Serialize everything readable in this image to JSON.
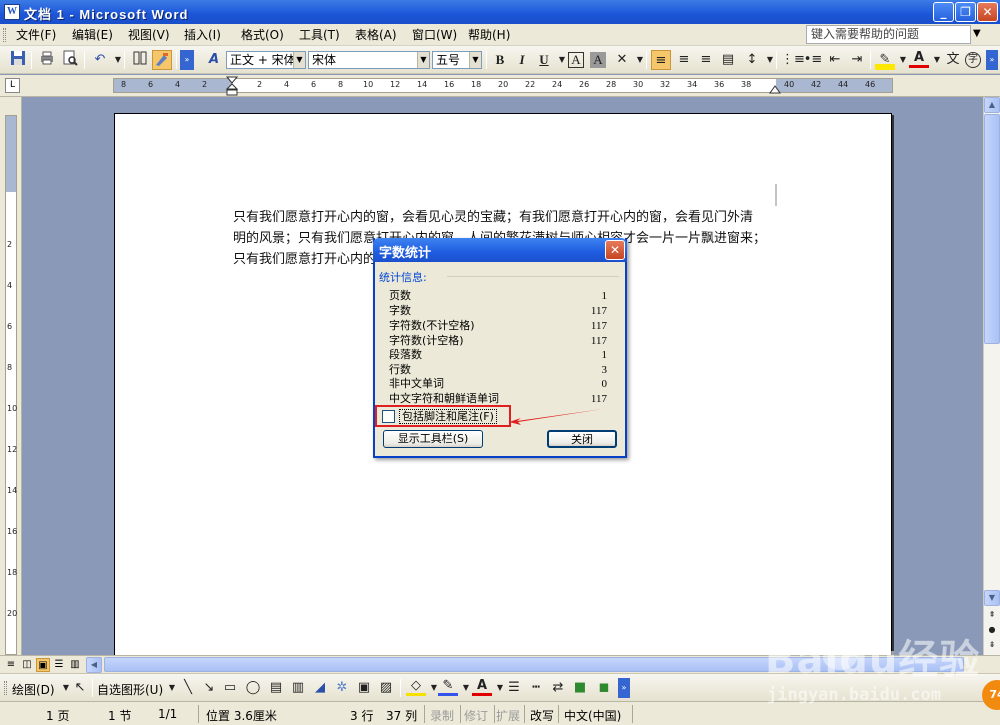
{
  "window": {
    "title": "文档 1 - Microsoft Word",
    "app_icon": "W",
    "controls": [
      "_",
      "❐",
      "✕"
    ]
  },
  "menubar": {
    "items": [
      "文件(F)",
      "编辑(E)",
      "视图(V)",
      "插入(I)",
      "格式(O)",
      "工具(T)",
      "表格(A)",
      "窗口(W)",
      "帮助(H)"
    ],
    "help_placeholder": "键入需要帮助的问题"
  },
  "toolbar": {
    "style_value": "正文 + 宋体",
    "font_value": "宋体",
    "size_value": "五号",
    "bold": "B",
    "italic": "I",
    "underline": "U",
    "char_border": "A",
    "char_shade": "A",
    "phonetic": "文",
    "icons": [
      "save-icon",
      "print-icon",
      "print-preview-icon",
      "undo-icon",
      "columns-icon",
      "drawing-icon",
      "styles-icon",
      "bold-icon",
      "italic-icon",
      "underline-icon",
      "align-left-icon",
      "center-icon",
      "align-right-icon",
      "justify-icon",
      "line-spacing-icon",
      "numbering-icon",
      "bullets-icon",
      "decrease-indent-icon",
      "increase-indent-icon",
      "highlight-icon",
      "font-color-icon"
    ]
  },
  "ruler": {
    "left_numbers": [
      "8",
      "6",
      "4",
      "2"
    ],
    "right_numbers": [
      "2",
      "4",
      "6",
      "8",
      "10",
      "12",
      "14",
      "16",
      "18",
      "20",
      "22",
      "24",
      "26",
      "28",
      "30",
      "32",
      "34",
      "36",
      "38",
      "40",
      "42",
      "44",
      "46",
      "48"
    ],
    "vertical_numbers": [
      "2",
      "4",
      "6",
      "8",
      "10",
      "12",
      "14",
      "16",
      "18",
      "20"
    ]
  },
  "document": {
    "line1": "只有我们愿意打开心内的窗，会看见心灵的宝藏；有我们愿意打开心内的窗，会看见门外清",
    "line2": "明的风景；只有我们愿意打开心内的窗，人间的繁花满树与师心相容才会一片一片飘进窗来；",
    "line3": "只有我们愿意打开心内的窗，才会让我们的生命走向光明的所在。↵"
  },
  "dialog": {
    "title": "字数统计",
    "group_label": "统计信息:",
    "stats": [
      {
        "label": "页数",
        "value": "1"
      },
      {
        "label": "字数",
        "value": "117"
      },
      {
        "label": "字符数(不计空格)",
        "value": "117"
      },
      {
        "label": "字符数(计空格)",
        "value": "117"
      },
      {
        "label": "段落数",
        "value": "1"
      },
      {
        "label": "行数",
        "value": "3"
      },
      {
        "label": "非中文单词",
        "value": "0"
      },
      {
        "label": "中文字符和朝鲜语单词",
        "value": "117"
      }
    ],
    "checkbox_label": "包括脚注和尾注(F)",
    "checkbox_checked": false,
    "show_toolbar_button": "显示工具栏(S)",
    "close_button": "关闭",
    "highlight_color": "#e02020"
  },
  "drawbar": {
    "draw_label": "绘图(D)",
    "autoshapes_label": "自选图形(U)"
  },
  "statusbar": {
    "page": "1 页",
    "section": "1 节",
    "page_of": "1/1",
    "position": "位置 3.6厘米",
    "line": "3 行",
    "column": "37 列",
    "rec": "录制",
    "trk": "修订",
    "ext": "扩展",
    "ovr": "改写",
    "lang": "中文(中国)"
  },
  "watermark": {
    "brand": "Baidu经验",
    "url": "jingyan.baidu.com",
    "badge": "74"
  }
}
